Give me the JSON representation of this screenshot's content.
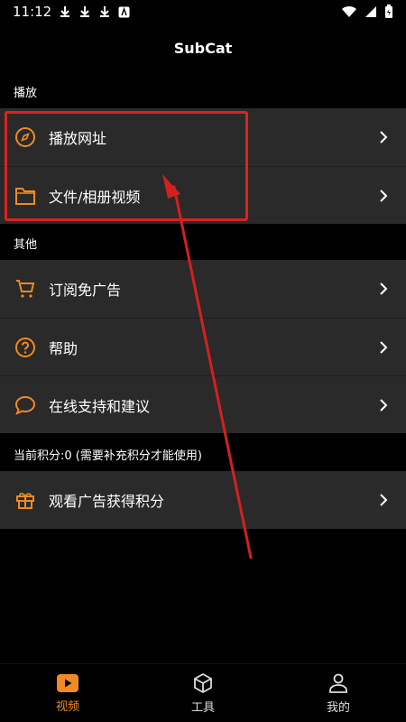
{
  "status": {
    "time": "11:12"
  },
  "app": {
    "title": "SubCat"
  },
  "sections": {
    "play": "播放",
    "other": "其他",
    "points": "当前积分:0 (需要补充积分才能使用)"
  },
  "items": {
    "play_url": "播放网址",
    "files": "文件/相册视频",
    "subscribe": "订阅免广告",
    "help": "帮助",
    "support": "在线支持和建议",
    "watch_ads": "观看广告获得积分"
  },
  "tabs": {
    "video": "视频",
    "tools": "工具",
    "mine": "我的"
  },
  "colors": {
    "accent": "#f08a24",
    "highlight": "#e02020",
    "item_bg": "#2a2a2a"
  }
}
